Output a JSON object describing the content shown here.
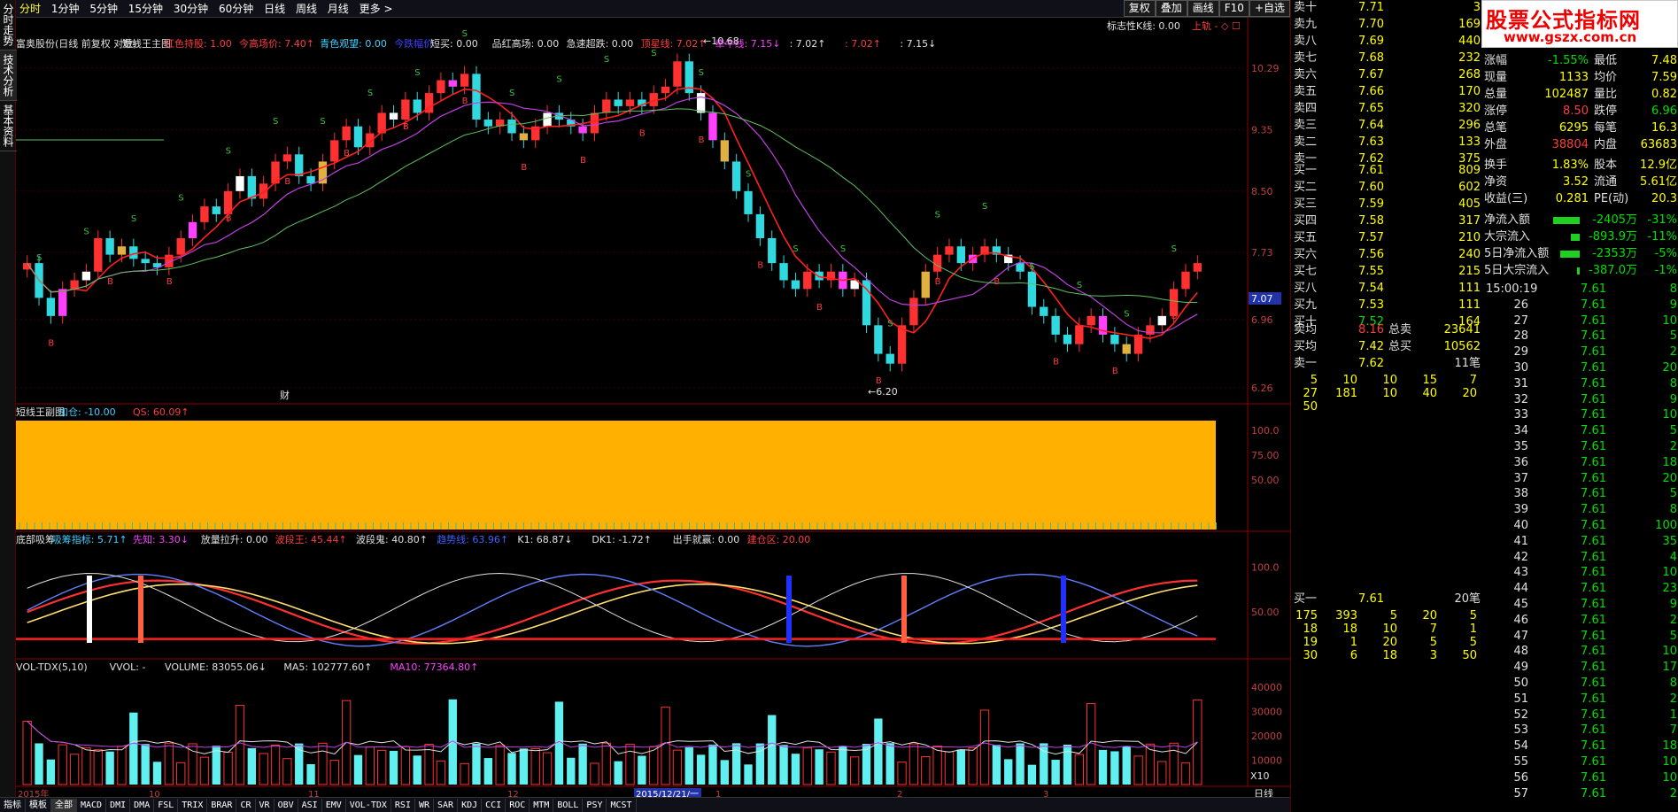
{
  "left_tabs": [
    "分时走势",
    "技术分析",
    "基本资料"
  ],
  "period_tabs": [
    "分时",
    "1分钟",
    "5分钟",
    "15分钟",
    "30分钟",
    "60分钟",
    "日线",
    "周线",
    "月线",
    "更多 >"
  ],
  "right_tools": [
    "复权",
    "叠加",
    "画线",
    "F10",
    "+自选"
  ],
  "main": {
    "title_items": [
      {
        "t": "富奥股份(日线 前复权 对数)",
        "c": "#e0e0e0"
      },
      {
        "t": "短线王主图",
        "c": "#e0e0e0"
      },
      {
        "t": "红色持股: 1.00",
        "c": "#ff3c3c"
      },
      {
        "t": "今高场价: 7.40↑",
        "c": "#ff3c3c"
      },
      {
        "t": "青色观望: 0.00",
        "c": "#40d0ff"
      },
      {
        "t": "今跌幅价",
        "c": "#4040ff"
      },
      {
        "t": "短买: 0.00",
        "c": "#e0e0e0"
      },
      {
        "t": "品红高场: 0.00",
        "c": "#e0e0e0"
      },
      {
        "t": "急速超跌: 0.00",
        "c": "#e0e0e0"
      },
      {
        "t": "顶星线: 7.02↑",
        "c": "#ff3c3c"
      },
      {
        "t": "牵牛线: 7.15↓",
        "c": "#ff40ff"
      },
      {
        "t": ": 7.02↑",
        "c": "#e0e0e0"
      },
      {
        "t": ": 7.02↑",
        "c": "#ff3c3c"
      },
      {
        "t": ": 7.15↓",
        "c": "#e0e0e0"
      }
    ],
    "right_title": "标志性K线: 0.00",
    "right_title2": "上轨 - ◇ ☐",
    "y_ticks": [
      "10.29",
      "9.35",
      "8.50",
      "7.73",
      "6.96",
      "6.26"
    ],
    "price_tag": "7.07",
    "high_label": "←10.68",
    "low_label": "←6.20",
    "cai_label": "财"
  },
  "sub1": {
    "title": "短线王副图",
    "items": [
      {
        "t": "加仓: -10.00",
        "c": "#40d0ff"
      },
      {
        "t": "QS: 60.09↑",
        "c": "#ff3c3c"
      }
    ],
    "y_ticks": [
      "100.0",
      "75.00",
      "50.00"
    ]
  },
  "sub2": {
    "items": [
      {
        "t": "底部吸筹",
        "c": "#e0e0e0"
      },
      {
        "t": "吸筹指标: 5.71↑",
        "c": "#40d0ff"
      },
      {
        "t": "先知: 3.30↓",
        "c": "#ff40ff"
      },
      {
        "t": "放量拉升: 0.00",
        "c": "#e0e0e0"
      },
      {
        "t": "波段王: 45.44↑",
        "c": "#ff3c3c"
      },
      {
        "t": "波段鬼: 40.80↑",
        "c": "#e0e0e0"
      },
      {
        "t": "趋势线: 63.96↑",
        "c": "#4060ff"
      },
      {
        "t": "K1: 68.87↓",
        "c": "#e0e0e0"
      },
      {
        "t": "DK1: -1.72↑",
        "c": "#e0e0e0"
      },
      {
        "t": "出手就赢: 0.00",
        "c": "#e0e0e0"
      },
      {
        "t": "建仓区: 20.00",
        "c": "#ff3c3c"
      }
    ],
    "y_ticks": [
      "100.0",
      "50.00"
    ]
  },
  "vol": {
    "items": [
      {
        "t": "VOL-TDX(5,10)",
        "c": "#e0e0e0"
      },
      {
        "t": "VVOL: -",
        "c": "#e0e0e0"
      },
      {
        "t": "VOLUME: 83055.06↓",
        "c": "#e0e0e0"
      },
      {
        "t": "MA5: 102777.60↑",
        "c": "#e0e0e0"
      },
      {
        "t": "MA10: 77364.80↑",
        "c": "#ff40ff"
      }
    ],
    "y_ticks": [
      "40000",
      "30000",
      "20000",
      "10000"
    ],
    "unit": "X10"
  },
  "xaxis": {
    "labels": [
      "2015年",
      "10",
      "11",
      "12",
      "2015/12/21/一",
      "1",
      "2",
      "3"
    ],
    "period": "日线"
  },
  "bottom_tabs": [
    "指标",
    "模板",
    "全部",
    "MACD",
    "DMI",
    "DMA",
    "FSL",
    "TRIX",
    "BRAR",
    "CR",
    "VR",
    "OBV",
    "ASI",
    "EMV",
    "VOL-TDX",
    "RSI",
    "WR",
    "SAR",
    "KDJ",
    "CCI",
    "ROC",
    "MTM",
    "BOLL",
    "PSY",
    "MCST"
  ],
  "panel": {
    "logo": {
      "big": "股票公式指标网",
      "small": "www.gszx.com.cn"
    },
    "sell": [
      {
        "l": "卖十",
        "p": "7.71",
        "v": "3"
      },
      {
        "l": "卖九",
        "p": "7.70",
        "v": "169"
      },
      {
        "l": "卖八",
        "p": "7.69",
        "v": "440"
      },
      {
        "l": "卖七",
        "p": "7.68",
        "v": "232"
      },
      {
        "l": "卖六",
        "p": "7.67",
        "v": "268"
      },
      {
        "l": "卖五",
        "p": "7.66",
        "v": "170"
      },
      {
        "l": "卖四",
        "p": "7.65",
        "v": "320"
      },
      {
        "l": "卖三",
        "p": "7.64",
        "v": "296"
      },
      {
        "l": "卖二",
        "p": "7.63",
        "v": "133"
      },
      {
        "l": "卖一",
        "p": "7.62",
        "v": "375"
      }
    ],
    "buy": [
      {
        "l": "买一",
        "p": "7.61",
        "v": "809"
      },
      {
        "l": "买二",
        "p": "7.60",
        "v": "602"
      },
      {
        "l": "买三",
        "p": "7.59",
        "v": "405"
      },
      {
        "l": "买四",
        "p": "7.58",
        "v": "317"
      },
      {
        "l": "买五",
        "p": "7.57",
        "v": "210"
      },
      {
        "l": "买六",
        "p": "7.56",
        "v": "240"
      },
      {
        "l": "买七",
        "p": "7.55",
        "v": "215"
      },
      {
        "l": "买八",
        "p": "7.54",
        "v": "111"
      },
      {
        "l": "买九",
        "p": "7.53",
        "v": "111"
      },
      {
        "l": "买十",
        "p": "7.52",
        "v": "164"
      }
    ],
    "avg": [
      {
        "l": "卖均",
        "p": "8.16",
        "k": "总卖",
        "v": "23641"
      },
      {
        "l": "买均",
        "p": "7.42",
        "k": "总买",
        "v": "10562"
      }
    ],
    "queue_sell": {
      "l": "卖一",
      "p": "7.62",
      "n": "11笔",
      "rows": [
        [
          "5",
          "10",
          "10",
          "15",
          "7"
        ],
        [
          "27",
          "181",
          "10",
          "40",
          "20"
        ],
        [
          "50",
          "",
          "",
          "",
          ""
        ]
      ]
    },
    "queue_buy": {
      "l": "买一",
      "p": "7.61",
      "n": "20笔",
      "rows": [
        [
          "175",
          "393",
          "5",
          "20",
          "5"
        ],
        [
          "18",
          "18",
          "10",
          "7",
          "1"
        ],
        [
          "19",
          "1",
          "20",
          "5",
          "5"
        ],
        [
          "30",
          "6",
          "18",
          "3",
          "50"
        ]
      ]
    },
    "stats": [
      [
        "涨幅",
        "-1.55%",
        "最低",
        "7.48"
      ],
      [
        "现量",
        "1133",
        "均价",
        "7.59"
      ],
      [
        "总量",
        "102487",
        "量比",
        "0.82"
      ],
      [
        "涨停",
        "8.50",
        "跌停",
        "6.96"
      ],
      [
        "总笔",
        "6295",
        "每笔",
        "16.3"
      ],
      [
        "外盘",
        "38804",
        "内盘",
        "63683"
      ],
      [
        "换手",
        "1.83%",
        "股本",
        "12.9亿"
      ],
      [
        "净资",
        "3.52",
        "流通",
        "5.61亿"
      ],
      [
        "收益(三)",
        "0.281",
        "PE(动)",
        "20.3"
      ]
    ],
    "flows": [
      {
        "l": "净流入额",
        "v": "-2405万",
        "p": "-31%",
        "w": 30
      },
      {
        "l": "大宗流入",
        "v": "-893.9万",
        "p": "-11%",
        "w": 10
      },
      {
        "l": "5日净流入额",
        "v": "-2353万",
        "p": "-5%",
        "w": 22
      },
      {
        "l": "5日大宗流入",
        "v": "-387.0万",
        "p": "-1%",
        "w": 3
      }
    ],
    "ticks_time": "15:00:19",
    "ticks": [
      [
        "",
        "7.61",
        "8"
      ],
      [
        "26",
        "7.61",
        "9"
      ],
      [
        "27",
        "7.61",
        "10"
      ],
      [
        "28",
        "7.61",
        "5"
      ],
      [
        "29",
        "7.61",
        "2"
      ],
      [
        "30",
        "7.61",
        "20"
      ],
      [
        "31",
        "7.61",
        "8"
      ],
      [
        "32",
        "7.61",
        "9"
      ],
      [
        "33",
        "7.61",
        "10"
      ],
      [
        "34",
        "7.61",
        "5"
      ],
      [
        "35",
        "7.61",
        "2"
      ],
      [
        "36",
        "7.61",
        "18"
      ],
      [
        "37",
        "7.61",
        "20"
      ],
      [
        "38",
        "7.61",
        "5"
      ],
      [
        "39",
        "7.61",
        "8"
      ],
      [
        "40",
        "7.61",
        "100"
      ],
      [
        "41",
        "7.61",
        "35"
      ],
      [
        "42",
        "7.61",
        "4"
      ],
      [
        "43",
        "7.61",
        "10"
      ],
      [
        "44",
        "7.61",
        "23"
      ],
      [
        "45",
        "7.61",
        "9"
      ],
      [
        "46",
        "7.61",
        "2"
      ],
      [
        "47",
        "7.61",
        "5"
      ],
      [
        "48",
        "7.61",
        "10"
      ],
      [
        "49",
        "7.61",
        "17"
      ],
      [
        "50",
        "7.61",
        "8"
      ],
      [
        "51",
        "7.61",
        "2"
      ],
      [
        "52",
        "7.61",
        "1"
      ],
      [
        "53",
        "7.61",
        "7"
      ],
      [
        "54",
        "7.61",
        "18"
      ],
      [
        "55",
        "7.61",
        "10"
      ],
      [
        "56",
        "7.61",
        "10"
      ],
      [
        "57",
        "7.61",
        "2"
      ]
    ]
  },
  "chart_data": {
    "type": "candlestick",
    "title": "富奥股份(日线 前复权 对数)",
    "x_range": [
      "2015-09",
      "2016-03"
    ],
    "y_range": [
      6.2,
      10.68
    ],
    "max_label": 10.68,
    "min_label": 6.2,
    "closes": [
      7.6,
      7.2,
      7.0,
      7.3,
      7.4,
      7.5,
      7.9,
      7.7,
      7.8,
      7.65,
      7.6,
      7.55,
      7.7,
      7.9,
      8.1,
      8.3,
      8.2,
      8.5,
      8.7,
      8.4,
      8.6,
      8.9,
      9.0,
      8.7,
      8.6,
      8.9,
      9.2,
      9.4,
      9.1,
      9.3,
      9.6,
      9.5,
      9.8,
      9.6,
      9.9,
      10.1,
      10.0,
      10.2,
      9.5,
      9.4,
      9.5,
      9.3,
      9.2,
      9.4,
      9.6,
      9.5,
      9.4,
      9.3,
      9.6,
      9.8,
      9.7,
      9.8,
      9.7,
      9.9,
      10.0,
      10.4,
      9.9,
      9.6,
      9.2,
      8.9,
      8.5,
      8.2,
      7.9,
      7.6,
      7.4,
      7.3,
      7.5,
      7.4,
      7.5,
      7.3,
      7.4,
      6.9,
      6.6,
      6.5,
      6.9,
      7.2,
      7.5,
      7.7,
      7.8,
      7.6,
      7.7,
      7.8,
      7.7,
      7.6,
      7.5,
      7.1,
      7.0,
      6.8,
      6.7,
      6.9,
      7.0,
      6.8,
      6.7,
      6.6,
      6.8,
      6.9,
      7.0,
      7.3,
      7.5,
      7.6
    ],
    "vol_ma10_last": 77364.8
  }
}
